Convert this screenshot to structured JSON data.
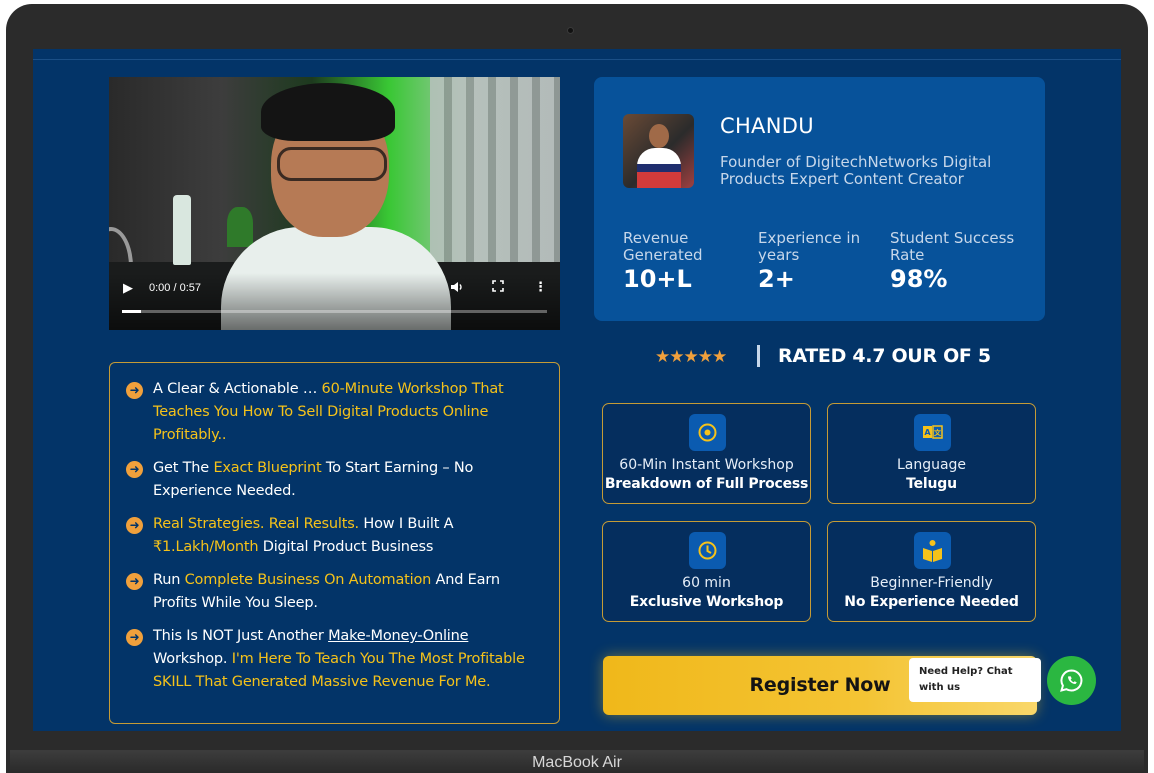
{
  "device": {
    "label": "MacBook Air"
  },
  "video": {
    "time": "0:00 / 0:57",
    "progress_fraction": 0.0,
    "controls": {
      "play_icon": "▶",
      "volume_icon": "🔊",
      "fullscreen_icon": "⛶",
      "more_icon": "⋮"
    }
  },
  "features": [
    {
      "parts": [
        {
          "t": "A Clear & Actionable … "
        },
        {
          "t": "60-Minute Workshop That Teaches You How To Sell Digital Products Online Profitably..",
          "hl": true
        }
      ]
    },
    {
      "parts": [
        {
          "t": "Get The "
        },
        {
          "t": "Exact Blueprint",
          "hl": true
        },
        {
          "t": " To Start Earning – No Experience Needed."
        }
      ]
    },
    {
      "parts": [
        {
          "t": "Real Strategies. Real Results.",
          "hl": true
        },
        {
          "t": " How I Built A "
        },
        {
          "t": "₹1.Lakh/Month",
          "hl": true
        },
        {
          "t": " Digital Product Business"
        }
      ]
    },
    {
      "parts": [
        {
          "t": "Run "
        },
        {
          "t": "Complete Business On Automation",
          "hl": true
        },
        {
          "t": " And Earn Profits While You Sleep."
        }
      ]
    },
    {
      "parts": [
        {
          "t": "This Is NOT Just Another "
        },
        {
          "t": "Make-Money-Online",
          "ul": true
        },
        {
          "t": " Workshop. "
        },
        {
          "t": "I'm Here To Teach You The Most Profitable SKILL That Generated Massive Revenue For Me.",
          "hl": true
        }
      ]
    }
  ],
  "profile": {
    "name": "CHANDU",
    "role": "Founder of DigitechNetworks Digital Products Expert Content Creator",
    "stats": [
      {
        "label": "Revenue Generated",
        "value": "10+L"
      },
      {
        "label": "Experience in years",
        "value": "2+"
      },
      {
        "label": "Student Success Rate",
        "value": "98%"
      }
    ]
  },
  "rating": {
    "stars": "★★★★★",
    "text": "RATED 4.7 OUR OF 5",
    "score": 4.7,
    "max": 5
  },
  "tiles": [
    {
      "icon": "target-icon",
      "glyph": "◉",
      "line1": "60-Min Instant Workshop",
      "line2": "Breakdown of Full Process"
    },
    {
      "icon": "translate-icon",
      "glyph": "A文",
      "line1": "Language",
      "line2": "Telugu"
    },
    {
      "icon": "clock-icon",
      "glyph": "◷",
      "line1": "60 min",
      "line2": "Exclusive Workshop"
    },
    {
      "icon": "book-reader-icon",
      "glyph": "📖",
      "line1": "Beginner-Friendly",
      "line2": "No Experience Needed"
    }
  ],
  "cta": {
    "register_label": "Register Now"
  },
  "chat": {
    "line1": "Need Help? Chat",
    "line2": "with us"
  },
  "colors": {
    "background": "#033468",
    "card": "#07529a",
    "accent_gold": "#f5c21a",
    "border_gold": "#c59b36",
    "whatsapp": "#2bb741"
  }
}
